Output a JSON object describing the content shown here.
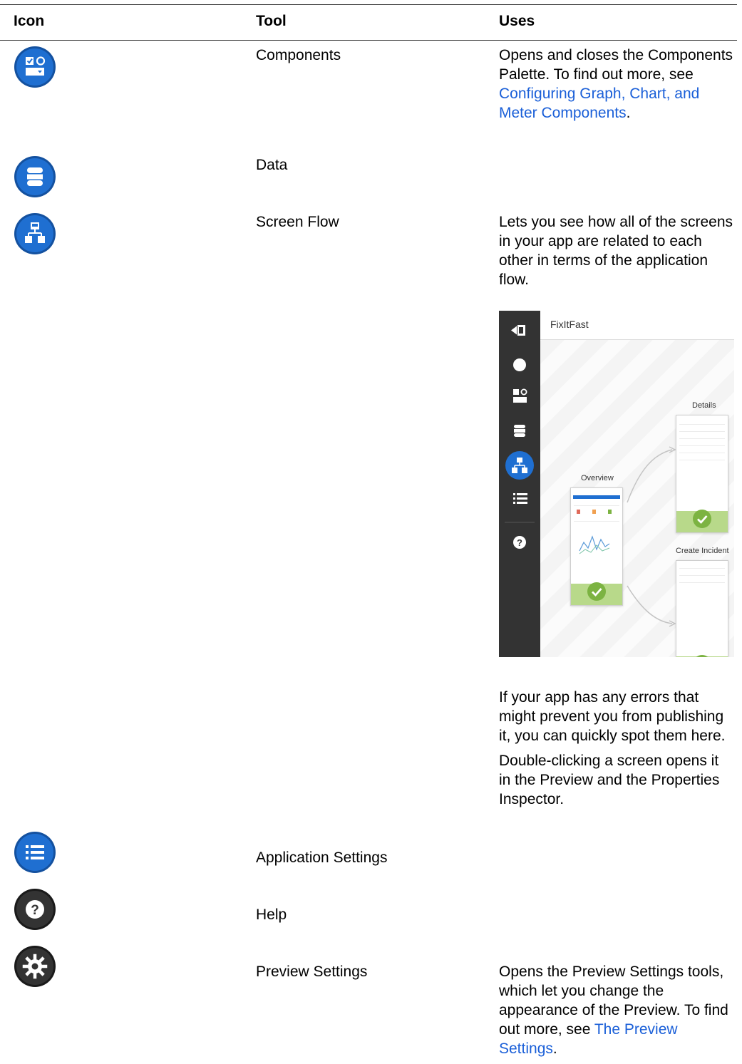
{
  "table": {
    "headers": {
      "icon": "Icon",
      "tool": "Tool",
      "uses": "Uses"
    },
    "rows": {
      "components": {
        "icon": "components-icon",
        "tool": "Components",
        "uses_before": "Opens and closes the Components Palette. To find out more, see ",
        "uses_link": "Configuring Graph, Chart, and Meter Components",
        "uses_after": "."
      },
      "data": {
        "icon": "database-icon",
        "tool": "Data"
      },
      "screen_flow": {
        "icon": "screen-flow-icon",
        "tool": "Screen Flow",
        "uses_p1": "Lets you see how all of the screens in your app are related to each other in terms of the application flow.",
        "uses_p2": "If your app has any errors that might prevent you from publishing it, you can quickly spot them here.",
        "uses_p3": "Double-clicking a screen opens it in the Preview and the Properties Inspector.",
        "figure": {
          "app_title": "FixItFast",
          "screens": {
            "overview": "Overview",
            "details": "Details",
            "create_incident": "Create Incident"
          }
        }
      },
      "application_settings": {
        "icon": "list-icon",
        "tool": "Application Settings"
      },
      "help": {
        "icon": "help-icon",
        "tool": "Help"
      },
      "preview_settings": {
        "icon": "gear-icon",
        "tool": "Preview Settings",
        "uses_before": "Opens the Preview Settings tools, which let you change the appearance of the Preview. To find out more, see ",
        "uses_link": "The Preview Settings",
        "uses_after": "."
      }
    }
  },
  "colors": {
    "blue_icon": "#1f6fd1",
    "dark_icon": "#333333",
    "link": "#1a5fd8",
    "success_green": "#7cb342",
    "success_bar": "#b8d98a"
  }
}
